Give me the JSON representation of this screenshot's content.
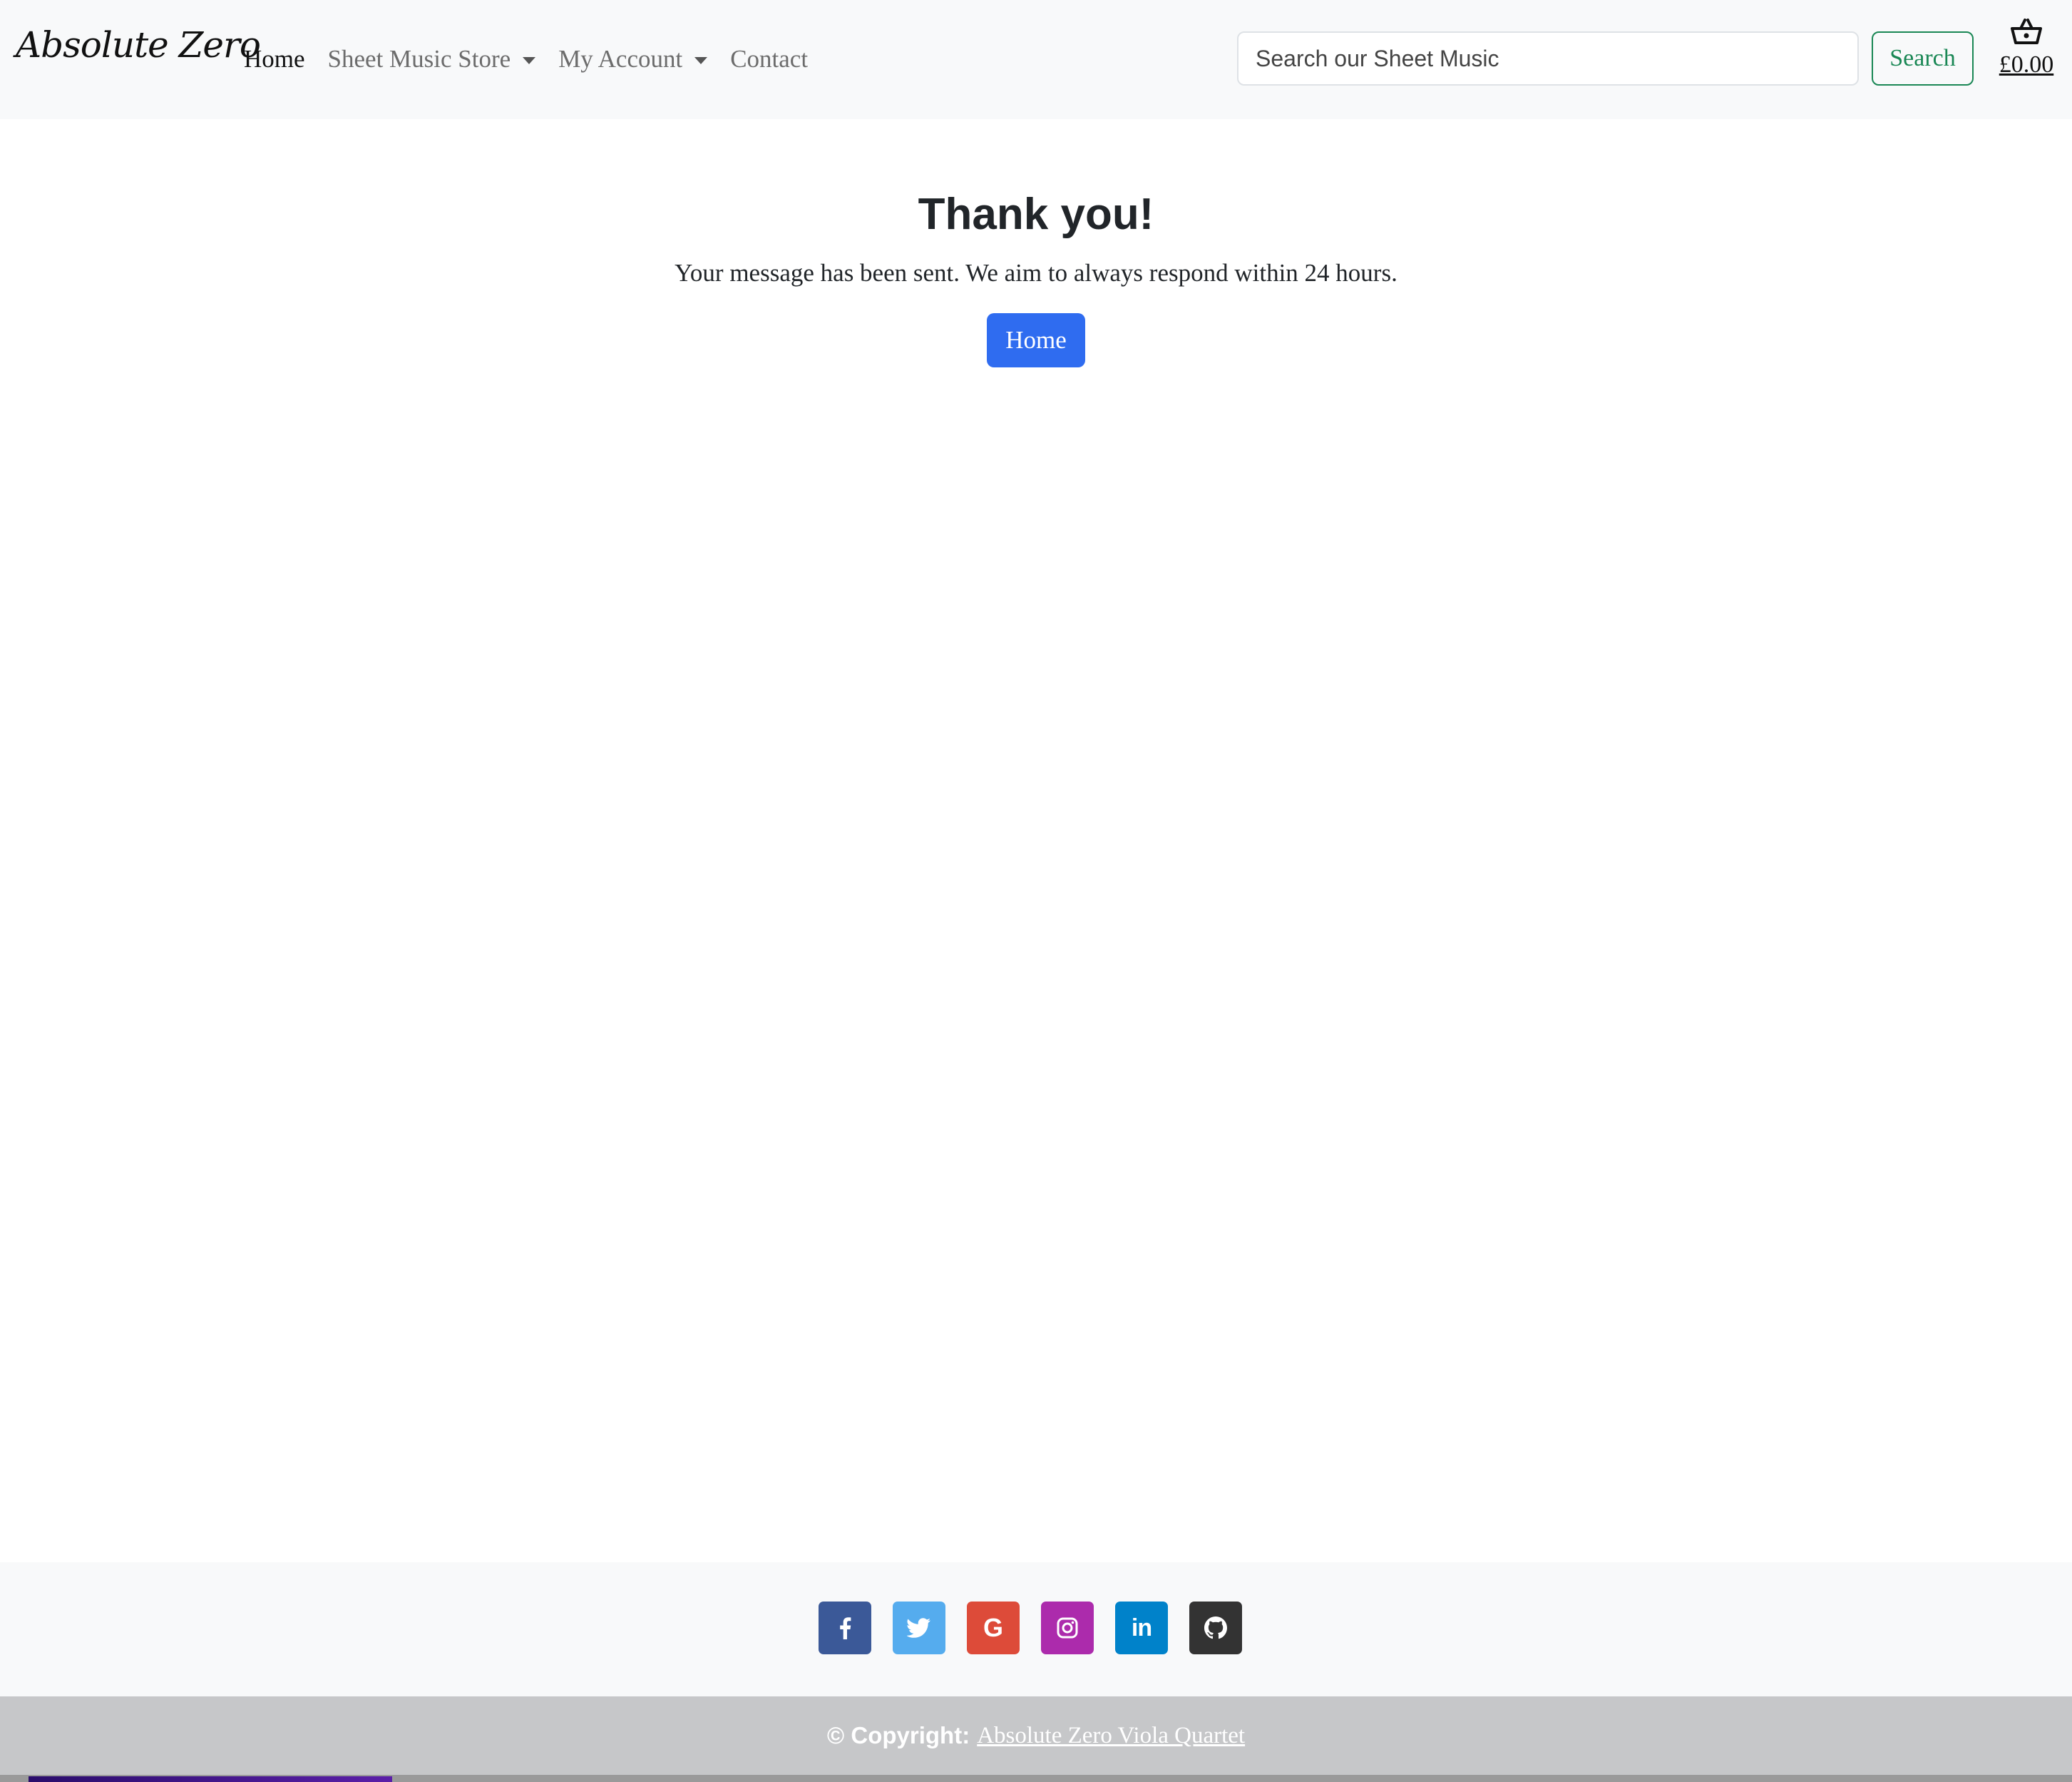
{
  "navbar": {
    "brand": "Absolute Zero",
    "links": [
      {
        "label": "Home"
      },
      {
        "label": "Sheet Music Store"
      },
      {
        "label": "My Account"
      },
      {
        "label": "Contact"
      }
    ],
    "search": {
      "placeholder": "Search our Sheet Music",
      "button_label": "Search"
    },
    "basket": {
      "icon": "basket-icon",
      "total": "£0.00"
    }
  },
  "main": {
    "title": "Thank you!",
    "message": "Your message has been sent. We aim to always respond within 24 hours.",
    "home_button": "Home"
  },
  "footer": {
    "social": [
      {
        "icon": "facebook-icon",
        "color": "#3b5998"
      },
      {
        "icon": "twitter-icon",
        "color": "#55acee"
      },
      {
        "icon": "google-icon",
        "color": "#dd4b39"
      },
      {
        "icon": "instagram-icon",
        "color": "#ac2bac"
      },
      {
        "icon": "linkedin-icon",
        "color": "#0082ca"
      },
      {
        "icon": "github-icon",
        "color": "#333333"
      }
    ],
    "copyright_label": "© Copyright:",
    "copyright_link": "Absolute Zero Viola Quartet"
  },
  "colors": {
    "primary": "#2f6cf0",
    "success": "#198754",
    "navbar_bg": "#f8f9fa",
    "footer_bg": "#c6c7c9"
  }
}
